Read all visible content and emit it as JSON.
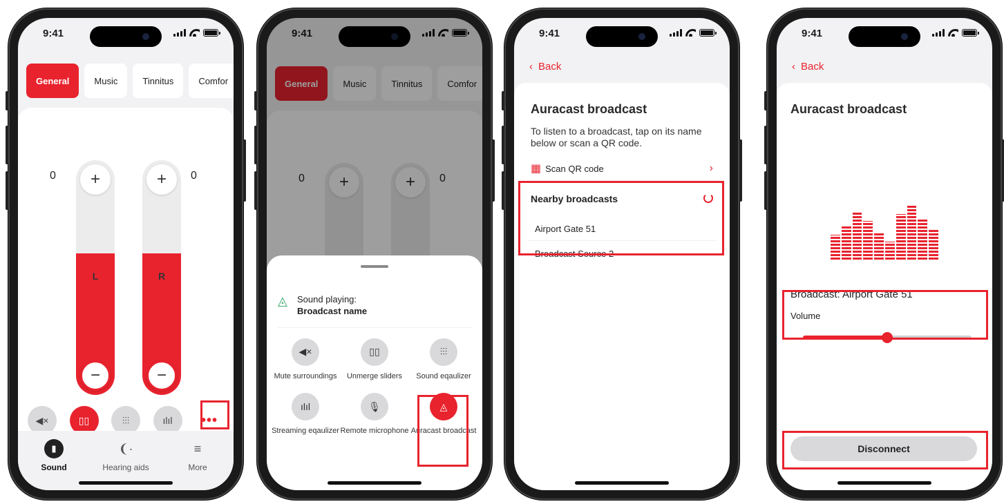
{
  "status": {
    "time": "9:41"
  },
  "screen1": {
    "tabs": [
      "General",
      "Music",
      "Tinnitus",
      "Comfor"
    ],
    "left_value": "0",
    "right_value": "0",
    "left_letter": "L",
    "right_letter": "R",
    "plus": "+",
    "minus": "−",
    "more_label": "•••",
    "nav": {
      "sound": "Sound",
      "hearing_aids": "Hearing aids",
      "more": "More"
    }
  },
  "screen2": {
    "sound_playing": "Sound playing:",
    "broadcast_name": "Broadcast name",
    "items": {
      "mute": "Mute surroundings",
      "unmerge": "Unmerge sliders",
      "sound_eq": "Sound eqaulizer",
      "streaming_eq": "Streaming eqaulizer",
      "remote_mic": "Remote microphone",
      "auracast": "Auracast broadcast"
    }
  },
  "screen3": {
    "back": "Back",
    "title": "Auracast broadcast",
    "description": "To listen to a broadcast, tap on its name below or scan a QR code.",
    "scan_qr": "Scan QR code",
    "nearby_title": "Nearby broadcasts",
    "broadcasts": [
      "Airport Gate 51",
      "Broadcast Source 2"
    ]
  },
  "screen4": {
    "back": "Back",
    "title": "Auracast broadcast",
    "broadcast_label": "Broadcast: Airport Gate 51",
    "volume_label": "Volume",
    "volume_level": 0.5,
    "disconnect": "Disconnect"
  },
  "colors": {
    "accent": "#e8232e",
    "control_bg": "#d9d9db"
  }
}
